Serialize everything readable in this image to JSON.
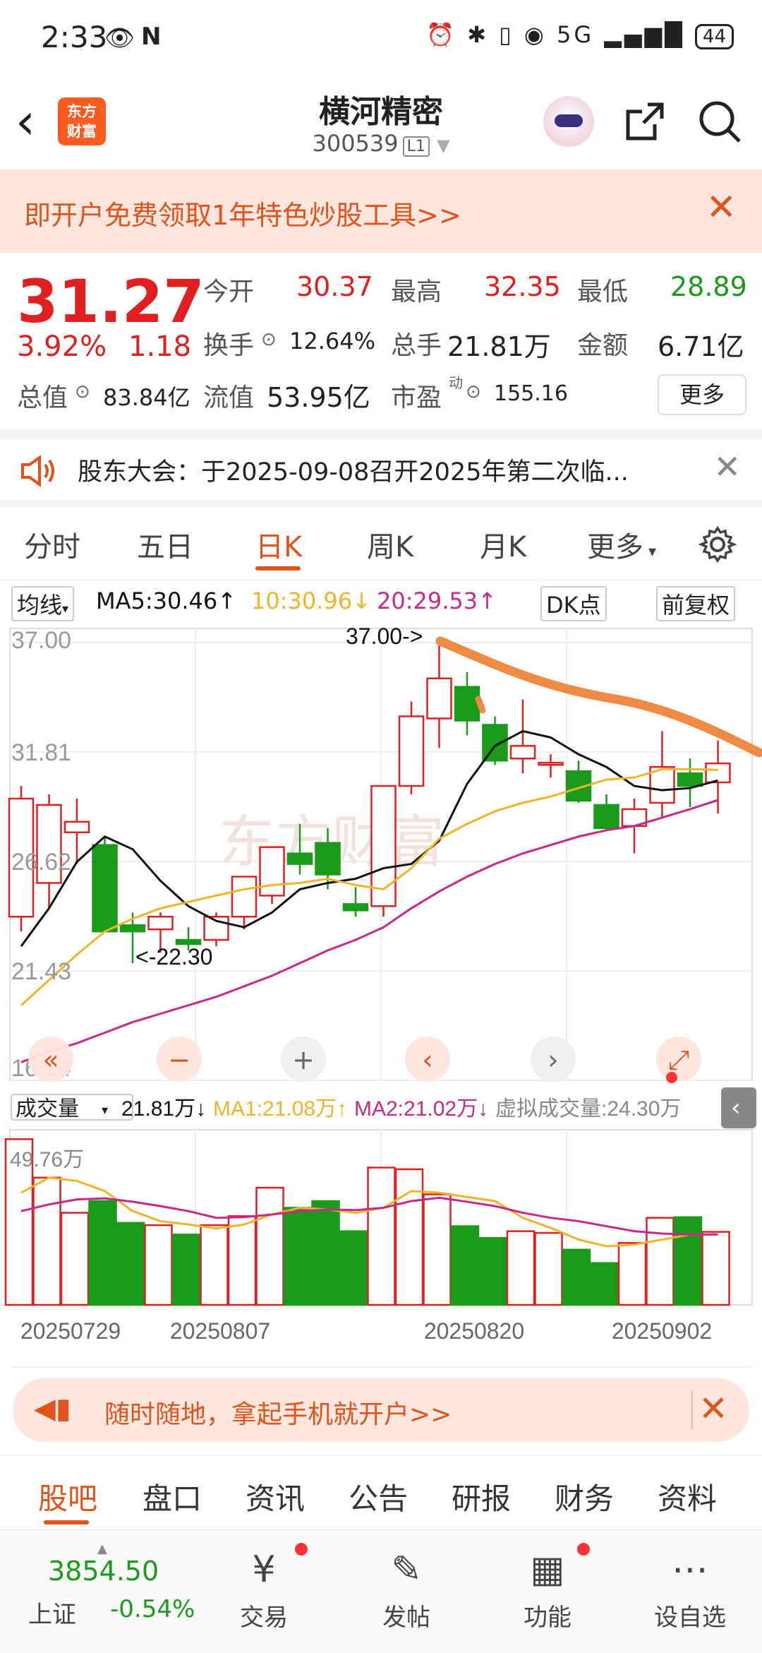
{
  "status_bar": {
    "time": "2:33",
    "battery": "44",
    "network": "5G"
  },
  "header": {
    "logo_line1": "东方",
    "logo_line2": "财富",
    "title": "横河精密",
    "code": "300539",
    "level": "L1"
  },
  "banner": {
    "text": "即开户免费领取1年特色炒股工具>>"
  },
  "quote": {
    "price": "31.27",
    "change_pct": "3.92%",
    "change": "1.18",
    "open_label": "今开",
    "open": "30.37",
    "high_label": "最高",
    "high": "32.35",
    "low_label": "最低",
    "low": "28.89",
    "turnover_label": "换手",
    "turnover": "12.64%",
    "volume_label": "总手",
    "volume": "21.81万",
    "amount_label": "金额",
    "amount": "6.71亿",
    "total_value_label": "总值",
    "total_value": "83.84亿",
    "float_value_label": "流值",
    "float_value": "53.95亿",
    "pe_label": "市盈",
    "pe_sup": "动",
    "pe": "155.16",
    "more": "更多"
  },
  "notice": {
    "text": "股东大会：于2025-09-08召开2025年第二次临..."
  },
  "tabs": [
    "分时",
    "五日",
    "日K",
    "周K",
    "月K",
    "更多"
  ],
  "active_tab": "日K",
  "ma_row": {
    "selector": "均线",
    "ma5": "MA5:30.46↑",
    "ma10": "10:30.96↓",
    "ma20": "20:29.53↑",
    "dk": "DK点",
    "fq": "前复权"
  },
  "volume_row": {
    "selector": "成交量",
    "vol": "21.81万↓",
    "ma1": "MA1:21.08万↑",
    "ma2": "MA2:21.02万↓",
    "virtual": "虚拟成交量:24.30万"
  },
  "colors": {
    "up": "#e02020",
    "down": "#1a9a1a",
    "accent": "#e0531b",
    "ma5": "#111111",
    "ma10": "#f0b428",
    "ma20": "#c8288c"
  },
  "chart_data": {
    "type": "candlestick",
    "y_ticks": [
      "37.00",
      "31.81",
      "26.62",
      "21.43",
      "16.24"
    ],
    "ylim": [
      16.24,
      37.0
    ],
    "x_labels": [
      "20250729",
      "20250807",
      "20250820",
      "20250902"
    ],
    "annotations": [
      "37.00->",
      "<-22.30"
    ],
    "watermark": "东方财富",
    "candles": [
      {
        "o": 24.0,
        "h": 30.2,
        "l": 23.3,
        "c": 29.6
      },
      {
        "o": 25.6,
        "h": 29.8,
        "l": 24.4,
        "c": 29.3
      },
      {
        "o": 28.0,
        "h": 29.6,
        "l": 26.5,
        "c": 28.5
      },
      {
        "o": 27.4,
        "h": 27.8,
        "l": 23.5,
        "c": 23.3
      },
      {
        "o": 23.6,
        "h": 24.2,
        "l": 21.8,
        "c": 23.3
      },
      {
        "o": 23.4,
        "h": 24.2,
        "l": 22.3,
        "c": 24.0
      },
      {
        "o": 22.9,
        "h": 23.5,
        "l": 22.4,
        "c": 22.7
      },
      {
        "o": 22.9,
        "h": 24.2,
        "l": 22.6,
        "c": 24.0
      },
      {
        "o": 24.0,
        "h": 25.9,
        "l": 23.4,
        "c": 25.9
      },
      {
        "o": 25.0,
        "h": 27.3,
        "l": 24.6,
        "c": 27.3
      },
      {
        "o": 27.0,
        "h": 28.4,
        "l": 26.0,
        "c": 26.5
      },
      {
        "o": 27.5,
        "h": 28.2,
        "l": 25.3,
        "c": 26.0
      },
      {
        "o": 24.6,
        "h": 25.4,
        "l": 24.0,
        "c": 24.3
      },
      {
        "o": 24.5,
        "h": 30.2,
        "l": 24.0,
        "c": 30.2
      },
      {
        "o": 30.2,
        "h": 34.2,
        "l": 29.8,
        "c": 33.5
      },
      {
        "o": 33.4,
        "h": 37.0,
        "l": 32.0,
        "c": 35.3
      },
      {
        "o": 34.9,
        "h": 35.6,
        "l": 32.6,
        "c": 33.3
      },
      {
        "o": 33.1,
        "h": 33.5,
        "l": 31.2,
        "c": 31.4
      },
      {
        "o": 31.5,
        "h": 34.3,
        "l": 30.8,
        "c": 32.1
      },
      {
        "o": 31.2,
        "h": 31.7,
        "l": 30.6,
        "c": 31.3
      },
      {
        "o": 30.9,
        "h": 31.4,
        "l": 29.4,
        "c": 29.5
      },
      {
        "o": 29.3,
        "h": 29.8,
        "l": 28.1,
        "c": 28.2
      },
      {
        "o": 28.3,
        "h": 29.6,
        "l": 27.0,
        "c": 29.1
      },
      {
        "o": 29.4,
        "h": 32.8,
        "l": 28.7,
        "c": 31.1
      },
      {
        "o": 30.8,
        "h": 31.5,
        "l": 29.2,
        "c": 30.2
      },
      {
        "o": 30.37,
        "h": 32.35,
        "l": 28.89,
        "c": 31.27
      }
    ],
    "ma5": [
      22.6,
      24.4,
      26.6,
      27.8,
      27.2,
      25.7,
      24.5,
      23.8,
      23.5,
      24.2,
      25.3,
      25.6,
      25.8,
      26.3,
      26.5,
      27.6,
      30.3,
      32.1,
      32.8,
      32.5,
      31.7,
      31.1,
      30.2,
      30.0,
      30.1,
      30.46
    ],
    "ma10": [
      19.8,
      21.0,
      22.2,
      23.3,
      23.9,
      24.4,
      24.7,
      25.0,
      25.3,
      25.5,
      25.6,
      25.8,
      25.5,
      25.3,
      26.3,
      27.7,
      28.4,
      29.0,
      29.4,
      29.7,
      30.1,
      30.5,
      30.6,
      31.0,
      31.0,
      30.96
    ],
    "ma20": [
      17.1,
      17.6,
      18.0,
      18.5,
      19.0,
      19.4,
      19.8,
      20.2,
      20.7,
      21.2,
      21.8,
      22.4,
      22.9,
      23.5,
      24.4,
      25.2,
      25.9,
      26.5,
      27.0,
      27.4,
      27.8,
      28.1,
      28.3,
      28.7,
      29.1,
      29.53
    ],
    "volume": {
      "max_label": "49.76万",
      "max": 49.76,
      "values": [
        49.5,
        38.0,
        27.5,
        31.0,
        24.5,
        23.8,
        21.0,
        23.8,
        26.5,
        35.0,
        29.0,
        31.0,
        22.0,
        41.0,
        40.5,
        33.0,
        23.5,
        20.0,
        22.0,
        21.5,
        16.5,
        12.5,
        18.5,
        26.0,
        26.2,
        21.81
      ],
      "ma1": [
        33.5,
        38.0,
        37.0,
        34.0,
        28.0,
        25.0,
        24.0,
        22.8,
        24.0,
        27.0,
        29.0,
        28.5,
        27.5,
        29.0,
        34.0,
        33.5,
        32.2,
        31.0,
        26.0,
        23.0,
        19.5,
        17.5,
        18.0,
        19.5,
        21.0,
        21.08
      ],
      "ma2": [
        28.0,
        30.0,
        31.5,
        31.8,
        30.8,
        29.5,
        28.0,
        26.0,
        26.2,
        27.0,
        28.0,
        28.5,
        28.3,
        29.0,
        31.0,
        32.0,
        30.8,
        29.5,
        27.5,
        26.0,
        25.0,
        23.5,
        22.0,
        21.3,
        21.0,
        21.02
      ]
    }
  },
  "chart_controls": [
    "«",
    "−",
    "+",
    "‹",
    "›",
    "⤢"
  ],
  "ad": {
    "text": "随时随地，拿起手机就开户>>"
  },
  "subtabs": [
    "股吧",
    "盘口",
    "资讯",
    "公告",
    "研报",
    "财务",
    "资料"
  ],
  "nav": {
    "index_value": "3854.50",
    "index_name": "上证",
    "index_change": "-0.54%",
    "items": [
      "交易",
      "发帖",
      "功能",
      "设自选"
    ]
  }
}
